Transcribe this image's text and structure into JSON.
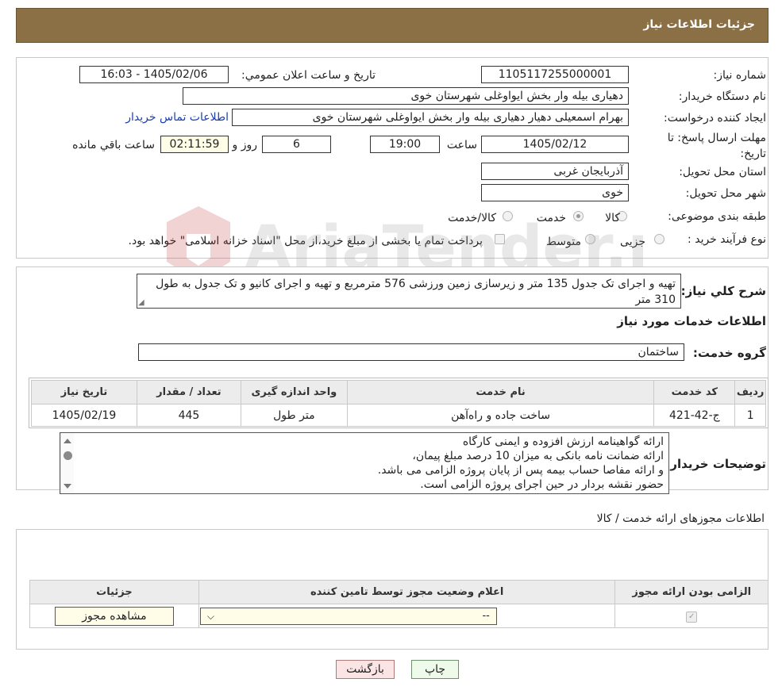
{
  "header": {
    "title": "جزئیات اطلاعات نیاز"
  },
  "need": {
    "number_label": "شماره نیاز:",
    "number_value": "1105117255000001",
    "announce_label": "تاريخ و ساعت اعلان عمومي:",
    "announce_value": "1405/02/06 - 16:03",
    "buyer_label": "نام دستگاه خریدار:",
    "buyer_value": "دهیاری بیله وار بخش ایواوغلی شهرستان خوی",
    "creator_label": "ایجاد کننده درخواست:",
    "creator_value": "بهرام اسمعیلی دهیار دهیاری بیله وار بخش ایواوغلی شهرستان خوی",
    "contact_link": "اطلاعات تماس خریدار",
    "deadline_label": "مهلت ارسال پاسخ: تا تاریخ:",
    "deadline_date": "1405/02/12",
    "time_label": "ساعت",
    "deadline_time": "19:00",
    "days_value": "6",
    "days_label": "روز و",
    "remaining_value": "02:11:59",
    "remaining_label": "ساعت باقي مانده",
    "province_label": "استان محل تحویل:",
    "province_value": "آذربایجان غربی",
    "city_label": "شهر محل تحویل:",
    "city_value": "خوی",
    "category_label": "طبقه بندی موضوعی:",
    "category_options": [
      "کالا",
      "خدمت",
      "کالا/خدمت"
    ],
    "category_selected": "خدمت",
    "process_label": "نوع فرآیند خرید :",
    "process_options": [
      "جزیی",
      "متوسط"
    ],
    "process_note": "پرداخت تمام یا بخشی از مبلغ خرید،از محل \"اسناد خزانه اسلامی\" خواهد بود."
  },
  "summary": {
    "label": "شرح كلي نياز:",
    "value": "تهیه و اجرای تک جدول 135 متر و زیرسازی زمین ورزشی 576 مترمربع و تهیه و اجرای کانیو و تک جدول به طول 310 متر"
  },
  "services": {
    "section_title": "اطلاعات خدمات مورد نياز",
    "group_label": "گروه خدمت:",
    "group_value": "ساختمان",
    "columns": [
      "رديف",
      "كد خدمت",
      "نام خدمت",
      "واحد اندازه گيری",
      "تعداد / مقدار",
      "تاريخ نياز"
    ],
    "rows": [
      {
        "row": "1",
        "code": "ج-42-421",
        "name": "ساخت جاده و راه‌آهن",
        "unit": "متر طول",
        "qty": "445",
        "date": "1405/02/19"
      }
    ]
  },
  "buyer_notes": {
    "label": "توضیحات خریدار:",
    "lines": [
      "ارائه گواهینامه ارزش افزوده و ایمنی کارگاه",
      "ارائه ضمانت نامه بانکی به میزان 10 درصد مبلغ پیمان،",
      "و ارائه مفاصا حساب بیمه پس از پایان پروژه الزامی می باشد.",
      "حضور نقشه بردار در حین اجرای پروژه الزامی است."
    ]
  },
  "permits": {
    "section_title": "اطلاعات مجوزهای ارائه خدمت / کالا",
    "columns": [
      "الزامی بودن ارائه مجوز",
      "اعلام وضعیت مجوز توسط تامین کننده",
      "جزئیات"
    ],
    "select_value": "--",
    "view_button": "مشاهده مجوز"
  },
  "actions": {
    "print": "چاپ",
    "back": "بازگشت"
  },
  "watermark": {
    "text": "AriaTender.neT"
  }
}
